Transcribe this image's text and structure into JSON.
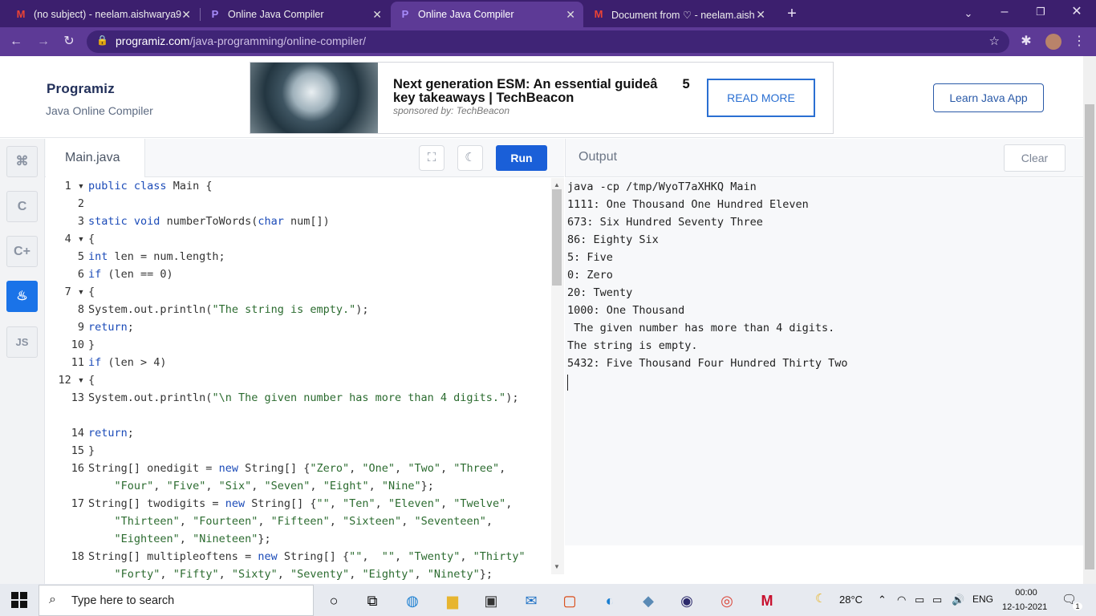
{
  "browser": {
    "tabs": [
      {
        "title": "(no subject) - neelam.aishwarya9",
        "icon": "gmail-icon"
      },
      {
        "title": "Online Java Compiler",
        "icon": "programiz-icon"
      },
      {
        "title": "Online Java Compiler",
        "icon": "programiz-icon",
        "active": true
      },
      {
        "title": "Document from ♡ - neelam.aish",
        "icon": "gmail-icon"
      }
    ],
    "url_host": "programiz.com",
    "url_path": "/java-programming/online-compiler/"
  },
  "header": {
    "logo": "Programiz",
    "subtitle": "Java Online Compiler",
    "ad_title": "Next generation ESM: An essential guideâ 5 key takeaways | TechBeacon",
    "ad_sponsor": "sponsored by: TechBeacon",
    "ad_button": "READ MORE",
    "learn_button": "Learn Java App"
  },
  "sidebar": {
    "items": [
      "python",
      "c",
      "cpp",
      "java",
      "JS"
    ]
  },
  "editor": {
    "filename": "Main.java",
    "run_label": "Run",
    "lines": [
      {
        "n": "1",
        "fold": true,
        "text": "public class Main {"
      },
      {
        "n": "2",
        "text": ""
      },
      {
        "n": "3",
        "text": "static void numberToWords(char num[])"
      },
      {
        "n": "4",
        "fold": true,
        "text": "{"
      },
      {
        "n": "5",
        "text": "int len = num.length;"
      },
      {
        "n": "6",
        "text": "if (len == 0)"
      },
      {
        "n": "7",
        "fold": true,
        "text": "{"
      },
      {
        "n": "8",
        "text": "System.out.println(\"The string is empty.\");"
      },
      {
        "n": "9",
        "text": "return;"
      },
      {
        "n": "10",
        "text": "}"
      },
      {
        "n": "11",
        "text": "if (len > 4)"
      },
      {
        "n": "12",
        "fold": true,
        "text": "{"
      },
      {
        "n": "13",
        "text": "System.out.println(\"\\n The given number has more than 4 digits.\");"
      },
      {
        "n": "",
        "text": ""
      },
      {
        "n": "14",
        "text": "return;"
      },
      {
        "n": "15",
        "text": "}"
      },
      {
        "n": "16",
        "text": "String[] onedigit = new String[] {\"Zero\", \"One\", \"Two\", \"Three\","
      },
      {
        "n": "",
        "text": "    \"Four\", \"Five\", \"Six\", \"Seven\", \"Eight\", \"Nine\"};"
      },
      {
        "n": "17",
        "text": "String[] twodigits = new String[] {\"\", \"Ten\", \"Eleven\", \"Twelve\","
      },
      {
        "n": "",
        "text": "    \"Thirteen\", \"Fourteen\", \"Fifteen\", \"Sixteen\", \"Seventeen\","
      },
      {
        "n": "",
        "text": "    \"Eighteen\", \"Nineteen\"};"
      },
      {
        "n": "18",
        "text": "String[] multipleoftens = new String[] {\"\",  \"\", \"Twenty\", \"Thirty\""
      },
      {
        "n": "",
        "text": "    \"Forty\", \"Fifty\", \"Sixty\", \"Seventy\", \"Eighty\", \"Ninety\"};"
      }
    ]
  },
  "output": {
    "label": "Output",
    "clear_label": "Clear",
    "lines": [
      "java -cp /tmp/WyoT7aXHKQ Main",
      "1111: One Thousand One Hundred Eleven",
      "673: Six Hundred Seventy Three",
      "86: Eighty Six",
      "5: Five",
      "0: Zero",
      "20: Twenty",
      "1000: One Thousand",
      " The given number has more than 4 digits.",
      "The string is empty.",
      "5432: Five Thousand Four Hundred Thirty Two"
    ]
  },
  "taskbar": {
    "search_placeholder": "Type here to search",
    "temperature": "28°C",
    "language": "ENG",
    "time": "00:00",
    "date": "12-10-2021",
    "notification_count": "1"
  }
}
